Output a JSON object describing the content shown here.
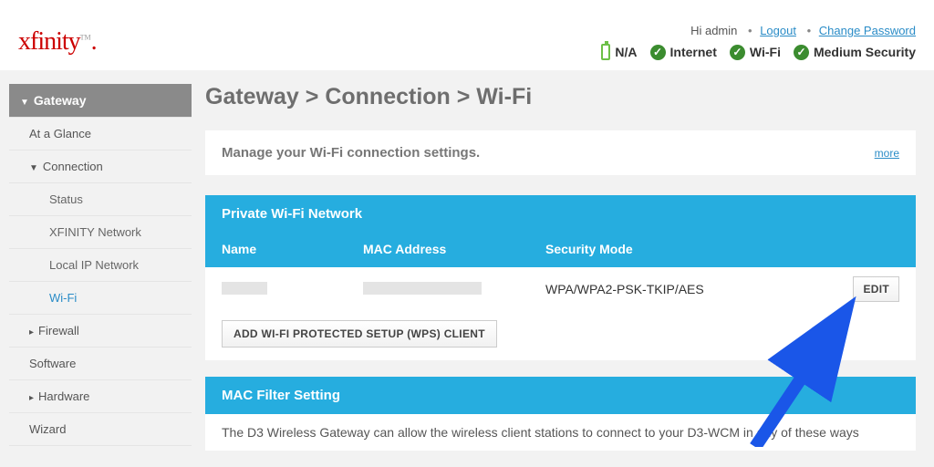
{
  "header": {
    "logo": "xfinity",
    "greeting": "Hi admin",
    "links": {
      "logout": "Logout",
      "change_password": "Change Password"
    },
    "status": {
      "battery": "N/A",
      "internet": "Internet",
      "wifi": "Wi-Fi",
      "security": "Medium Security"
    }
  },
  "sidebar": {
    "items": [
      {
        "label": "Gateway"
      },
      {
        "label": "At a Glance"
      },
      {
        "label": "Connection"
      },
      {
        "label": "Status"
      },
      {
        "label": "XFINITY Network"
      },
      {
        "label": "Local IP Network"
      },
      {
        "label": "Wi-Fi"
      },
      {
        "label": "Firewall"
      },
      {
        "label": "Software"
      },
      {
        "label": "Hardware"
      },
      {
        "label": "Wizard"
      }
    ]
  },
  "main": {
    "breadcrumb": "Gateway > Connection > Wi-Fi",
    "description": "Manage your Wi-Fi connection settings.",
    "more": "more",
    "private_panel": {
      "title": "Private Wi-Fi Network",
      "col_name": "Name",
      "col_mac": "MAC Address",
      "col_sec": "Security Mode",
      "row_sec": "WPA/WPA2-PSK-TKIP/AES",
      "edit": "EDIT",
      "wps_button": "ADD WI-FI PROTECTED SETUP (WPS) CLIENT"
    },
    "filter_panel": {
      "title": "MAC Filter Setting",
      "text": "The D3 Wireless Gateway can allow the wireless client stations to connect to your D3-WCM in any of these ways"
    }
  }
}
